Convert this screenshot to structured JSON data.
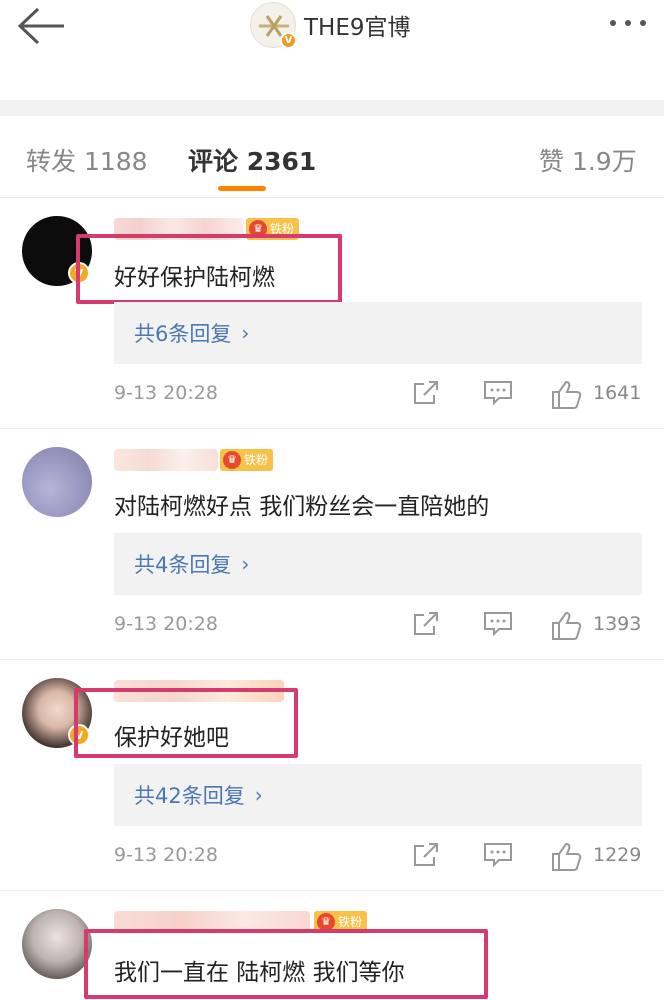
{
  "header": {
    "title": "THE9官博",
    "logo_badge": "V",
    "back_icon": "arrow-left-icon",
    "more_icon": "more-dots-icon"
  },
  "tabs": [
    {
      "label": "转发 1188",
      "active": false
    },
    {
      "label": "评论 2361",
      "active": true
    },
    {
      "label": "赞 1.9万",
      "active": false
    }
  ],
  "colors": {
    "accent": "#ff8200",
    "link": "#4a78b0",
    "highlight": "#d63b6d",
    "badge": "#f8c24a"
  },
  "comments": [
    {
      "badge": "铁粉",
      "text": "好好保护陆柯燃",
      "replies": "共6条回复",
      "time": "9-13 20:28",
      "likes": "1641",
      "verified": true,
      "highlighted": true
    },
    {
      "badge": "铁粉",
      "text": "对陆柯燃好点 我们粉丝会一直陪她的",
      "replies": "共4条回复",
      "time": "9-13 20:28",
      "likes": "1393",
      "verified": false,
      "highlighted": false
    },
    {
      "badge": "",
      "text": "保护好她吧",
      "replies": "共42条回复",
      "time": "9-13 20:28",
      "likes": "1229",
      "verified": true,
      "highlighted": true
    },
    {
      "badge": "铁粉",
      "text": "我们一直在 陆柯燃 我们等你",
      "replies": "",
      "time": "",
      "likes": "",
      "verified": false,
      "highlighted": true
    }
  ]
}
